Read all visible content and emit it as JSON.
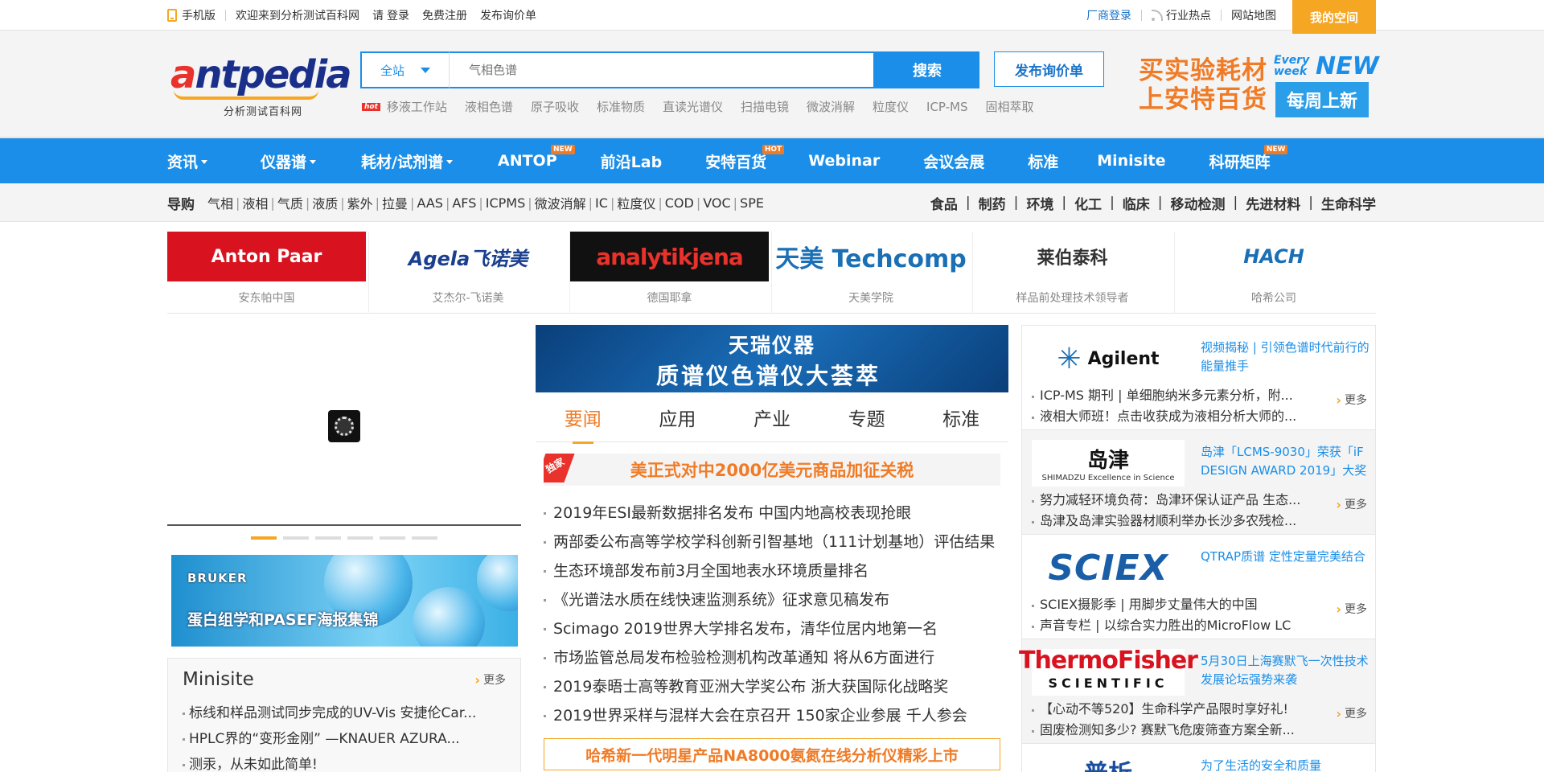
{
  "topbar": {
    "mobile": "手机版",
    "welcome": "欢迎来到分析测试百科网",
    "please": "请",
    "login": "登录",
    "register": "免费注册",
    "post_inquiry": "发布询价单",
    "vendor_login": "厂商登录",
    "hot": "行业热点",
    "sitemap": "网站地图",
    "my_space": "我的空间"
  },
  "logo": {
    "main_a": "a",
    "main_rest": "ntpedia",
    "sub": "分析测试百科网"
  },
  "search": {
    "scope": "全站",
    "placeholder": "气相色谱",
    "button": "搜索",
    "inquiry_button": "发布询价单",
    "hot_icon": "hot",
    "hot_words": [
      "移液工作站",
      "液相色谱",
      "原子吸收",
      "标准物质",
      "直读光谱仪",
      "扫描电镜",
      "微波消解",
      "粒度仪",
      "ICP-MS",
      "固相萃取"
    ]
  },
  "header_ad": {
    "line1": "买实验耗材",
    "line2": "上安特百货",
    "every": "Every week",
    "new": "NEW",
    "weekly": "每周上新"
  },
  "nav": [
    {
      "label": "资讯",
      "caret": true,
      "badge": ""
    },
    {
      "label": "仪器谱",
      "caret": true,
      "badge": ""
    },
    {
      "label": "耗材/试剂谱",
      "caret": true,
      "badge": ""
    },
    {
      "label": "ANTOP",
      "caret": false,
      "badge": "NEW"
    },
    {
      "label": "前沿Lab",
      "caret": false,
      "badge": ""
    },
    {
      "label": "安特百货",
      "caret": false,
      "badge": "HOT"
    },
    {
      "label": "Webinar",
      "caret": false,
      "badge": ""
    },
    {
      "label": "会议会展",
      "caret": false,
      "badge": ""
    },
    {
      "label": "标准",
      "caret": false,
      "badge": ""
    },
    {
      "label": "Minisite",
      "caret": false,
      "badge": ""
    },
    {
      "label": "科研矩阵",
      "caret": false,
      "badge": "NEW"
    }
  ],
  "subnav": {
    "title": "导购",
    "links": [
      "气相",
      "液相",
      "气质",
      "液质",
      "紫外",
      "拉曼",
      "AAS",
      "AFS",
      "ICPMS",
      "微波消解",
      "IC",
      "粒度仪",
      "COD",
      "VOC",
      "SPE"
    ],
    "categories": [
      "食品",
      "制药",
      "环境",
      "化工",
      "临床",
      "移动检测",
      "先进材料",
      "生命科学"
    ]
  },
  "brands": [
    {
      "logo": "Anton Paar",
      "name": "安东帕中国"
    },
    {
      "logo": "Agela飞诺美",
      "name": "艾杰尔-飞诺美"
    },
    {
      "logo": "analytikjena",
      "name": "德国耶拿"
    },
    {
      "logo": "天美 Techcomp",
      "name": "天美学院"
    },
    {
      "logo": "莱伯泰科",
      "name": "样品前处理技术领导者"
    },
    {
      "logo": "HACH",
      "name": "哈希公司"
    }
  ],
  "left": {
    "bruker_logo": "BRUKER",
    "bruker_text": "蛋白组学和PASEF海报集锦",
    "minisite_title": "Minisite",
    "more": "更多",
    "minisite_items": [
      "标线和样品测试同步完成的UV-Vis 安捷伦Car...",
      "HPLC界的“变形金刚” —KNAUER AZURA...",
      "测汞，从未如此简单!"
    ]
  },
  "mid": {
    "banner_line1": "天瑞仪器",
    "banner_line2": "质谱仪色谱仪大荟萃",
    "tabs": [
      "要闻",
      "应用",
      "产业",
      "专题",
      "标准"
    ],
    "headline_tag": "独家",
    "headline": "美正式对中2000亿美元商品加征关税",
    "news": [
      "2019年ESI最新数据排名发布 中国内地高校表现抢眼",
      "两部委公布高等学校学科创新引智基地（111计划基地）评估结果",
      "生态环境部发布前3月全国地表水环境质量排名",
      "《光谱法水质在线快速监测系统》征求意见稿发布",
      "Scimago 2019世界大学排名发布，清华位居内地第一名",
      "市场监管总局发布检验检测机构改革通知 将从6方面进行",
      "2019泰晤士高等教育亚洲大学奖公布 浙大获国际化战略奖",
      "2019世界采样与混样大会在京召开 150家企业参展 千人参会"
    ],
    "bottom_ad": "哈希新一代明星产品NA8000氨氮在线分析仪精彩上市"
  },
  "right": {
    "more": "更多",
    "sponsors": [
      {
        "logo": "Agilent",
        "logo_sub": "",
        "title": "视频揭秘 | 引领色谱时代前行的能量推手",
        "items": [
          "ICP-MS 期刊 | 单细胞纳米多元素分析，附...",
          "液相大师班！点击收获成为液相分析大师的..."
        ]
      },
      {
        "logo": "岛津",
        "logo_sub": "SHIMADZU Excellence in Science",
        "title": "岛津「LCMS-9030」荣获「iF DESIGN AWARD 2019」大奖",
        "items": [
          "努力减轻环境负荷：岛津环保认证产品 生态...",
          "岛津及岛津实验器材顺利举办长沙多农残检..."
        ]
      },
      {
        "logo": "SCIEX",
        "logo_sub": "",
        "title": "QTRAP质谱 定性定量完美结合",
        "items": [
          "SCIEX摄影季 | 用脚步丈量伟大的中国",
          "声音专栏 | 以综合实力胜出的MicroFlow LC"
        ]
      },
      {
        "logo": "ThermoFisher",
        "logo_sub": "SCIENTIFIC",
        "title": "5月30日上海赛默飞一次性技术发展论坛强势来袭",
        "items": [
          "【心动不等520】生命科学产品限时享好礼!",
          "固废检测知多少? 赛默飞危废筛查方案全新..."
        ]
      },
      {
        "logo": "普析",
        "logo_sub": "",
        "title": "为了生活的安全和质量",
        "items": []
      }
    ]
  }
}
